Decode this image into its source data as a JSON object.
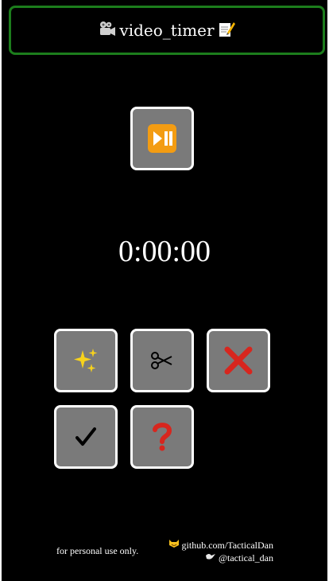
{
  "header": {
    "title": "video_timer",
    "left_icon": "movie-camera-icon",
    "right_icon": "memo-icon"
  },
  "controls": {
    "play_pause": {
      "icon": "play-pause-icon"
    }
  },
  "timer": {
    "value": "0:00:00"
  },
  "actions": [
    {
      "icon": "sparkles-icon"
    },
    {
      "icon": "scissors-icon"
    },
    {
      "icon": "cross-mark-icon"
    },
    {
      "icon": "check-mark-icon"
    },
    {
      "icon": "question-mark-icon"
    }
  ],
  "footer": {
    "notice": "for personal use only.",
    "github": "github.com/TacticalDan",
    "handle": "@tactical_dan"
  },
  "colors": {
    "background": "#000000",
    "header_border": "#1c7d1c",
    "button_fill": "#7a7a7a",
    "button_border": "#ffffff",
    "play_icon": "#f39c12",
    "cross_icon": "#d7261e",
    "question_icon": "#d7261e"
  }
}
